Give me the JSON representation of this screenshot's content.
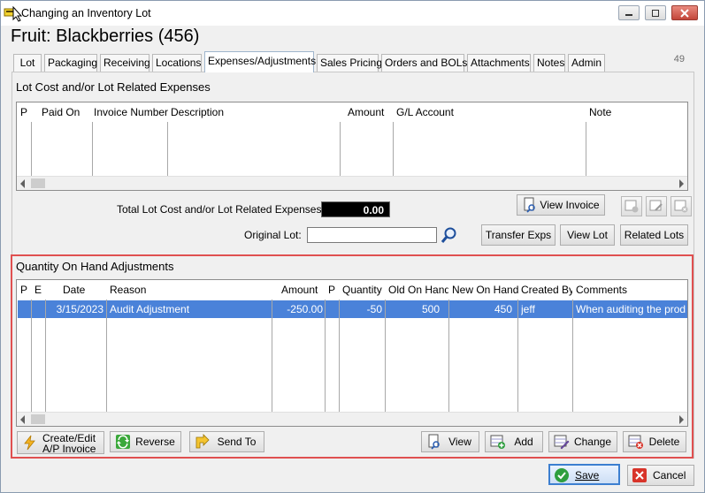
{
  "window": {
    "title": "Changing an Inventory Lot",
    "heading": "Fruit: Blackberries (456)",
    "corner_number": "49"
  },
  "tabs": [
    {
      "label": "Lot"
    },
    {
      "label": "Packaging"
    },
    {
      "label": "Receiving"
    },
    {
      "label": "Locations"
    },
    {
      "label": "Expenses/Adjustments",
      "active": true
    },
    {
      "label": "Sales Pricing"
    },
    {
      "label": "Orders and BOLs"
    },
    {
      "label": "Attachments"
    },
    {
      "label": "Notes"
    },
    {
      "label": "Admin"
    }
  ],
  "expenses": {
    "title": "Lot Cost and/or Lot Related Expenses",
    "columns": [
      "P",
      "Paid On",
      "Invoice Number",
      "Description",
      "Amount",
      "G/L Account",
      "Note"
    ],
    "total_label": "Total Lot Cost and/or Lot Related Expenses:",
    "total_value": "0.00",
    "original_lot_label": "Original Lot:",
    "original_lot_value": "",
    "buttons": {
      "view_invoice": "View Invoice",
      "transfer_exps": "Transfer Exps",
      "view_lot": "View Lot",
      "related_lots": "Related Lots"
    }
  },
  "qoh": {
    "title": "Quantity On Hand Adjustments",
    "columns": [
      "P",
      "E",
      "Date",
      "Reason",
      "Amount",
      "P",
      "Quantity",
      "Old On Hand",
      "New On Hand",
      "Created By",
      "Comments"
    ],
    "rows": [
      {
        "p": "",
        "e": "",
        "date": "3/15/2023",
        "reason": "Audit Adjustment",
        "amount": "-250.00",
        "p2": "",
        "quantity": "-50",
        "old_on_hand": "500",
        "new_on_hand": "450",
        "created_by": "jeff",
        "comments": "When auditing the prod"
      }
    ],
    "buttons": {
      "create_edit_line1": "Create/Edit",
      "create_edit_line2": "A/P Invoice",
      "reverse": "Reverse",
      "send_to": "Send To",
      "view": "View",
      "add": "Add",
      "change": "Change",
      "delete": "Delete"
    }
  },
  "footer": {
    "save": "Save",
    "cancel": "Cancel"
  }
}
